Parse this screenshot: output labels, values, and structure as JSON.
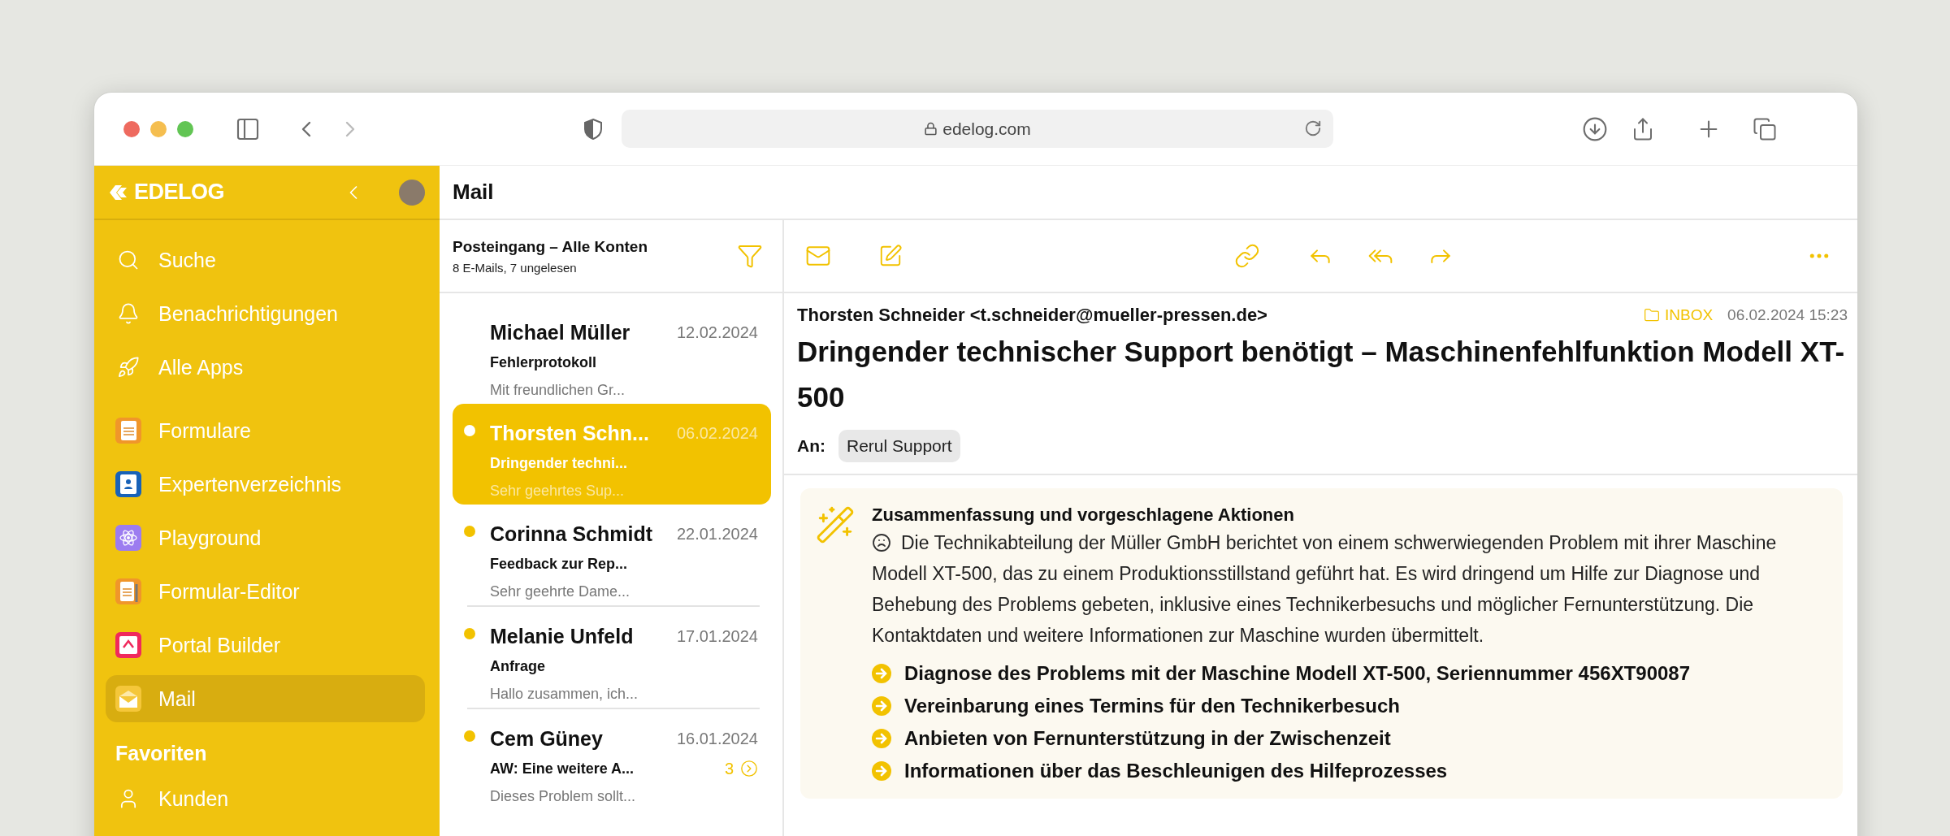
{
  "browser": {
    "url": "edelog.com"
  },
  "sidebar": {
    "brand": "EDELOG",
    "nav": [
      {
        "label": "Suche",
        "selected": false
      },
      {
        "label": "Benachrichtigungen",
        "selected": false
      },
      {
        "label": "Alle Apps",
        "selected": false
      }
    ],
    "apps": [
      {
        "label": "Formulare",
        "selected": false
      },
      {
        "label": "Expertenverzeichnis",
        "selected": false
      },
      {
        "label": "Playground",
        "selected": false
      },
      {
        "label": "Formular-Editor",
        "selected": false
      },
      {
        "label": "Portal Builder",
        "selected": false
      },
      {
        "label": "Mail",
        "selected": true
      }
    ],
    "favorites_title": "Favoriten",
    "favorites": [
      {
        "label": "Kunden",
        "selected": false
      }
    ]
  },
  "header": {
    "title": "Mail"
  },
  "mail_list": {
    "title": "Posteingang – Alle Konten",
    "subtitle": "8 E-Mails, 7 ungelesen",
    "rows": [
      {
        "sender": "Michael Müller",
        "date": "12.02.2024",
        "subject": "Fehlerprotokoll",
        "preview": "Mit freundlichen Gr...",
        "unread": false,
        "selected": false
      },
      {
        "sender": "Thorsten Schn...",
        "date": "06.02.2024",
        "subject": "Dringender techni...",
        "preview": "Sehr geehrtes Sup...",
        "unread": true,
        "selected": true
      },
      {
        "sender": "Corinna Schmidt",
        "date": "22.01.2024",
        "subject": "Feedback zur Rep...",
        "preview": "Sehr geehrte Dame...",
        "unread": true,
        "selected": false
      },
      {
        "sender": "Melanie Unfeld",
        "date": "17.01.2024",
        "subject": "Anfrage",
        "preview": "Hallo zusammen, ich...",
        "unread": true,
        "selected": false
      },
      {
        "sender": "Cem Güney",
        "date": "16.01.2024",
        "subject": "AW: Eine weitere A...",
        "preview": "Dieses Problem sollt...",
        "unread": true,
        "selected": false,
        "thread_count": "3"
      }
    ]
  },
  "message": {
    "from": "Thorsten Schneider <t.schneider@mueller-pressen.de>",
    "folder": "INBOX",
    "datetime": "06.02.2024 15:23",
    "subject": "Dringender technischer Support benötigt – Maschinenfehlfunktion Modell XT-500",
    "to_label": "An:",
    "recipients": [
      "Rerul Support"
    ],
    "summary": {
      "title": "Zusammenfassung und vorgeschlagene Aktionen",
      "text": "Die Technikabteilung der Müller GmbH berichtet von einem schwerwiegenden Problem mit ihrer Maschine Modell XT-500, das zu einem Produktionsstillstand geführt hat. Es wird dringend um Hilfe zur Diagnose und Behebung des Problems gebeten, inklusive eines Technikerbesuchs und möglicher Fernunterstützung. Die Kontaktdaten und weitere Informationen zur Maschine wurden übermittelt.",
      "actions": [
        "Diagnose des Problems mit der Maschine Modell XT-500, Seriennummer 456XT90087",
        "Vereinbarung eines Termins für den Technikerbesuch",
        "Anbieten von Fernunterstützung in der Zwischenzeit",
        "Informationen über das Beschleunigen des Hilfeprozesses"
      ]
    }
  }
}
